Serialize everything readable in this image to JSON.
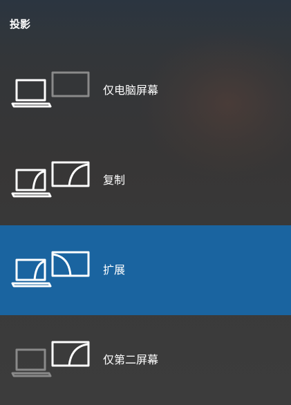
{
  "panel": {
    "title": "投影"
  },
  "options": [
    {
      "label": "仅电脑屏幕",
      "selected": false
    },
    {
      "label": "复制",
      "selected": false
    },
    {
      "label": "扩展",
      "selected": true
    },
    {
      "label": "仅第二屏幕",
      "selected": false
    }
  ],
  "colors": {
    "selected_background": "#1a64a0",
    "icon_active": "#ffffff",
    "icon_inactive": "#8a8a8a"
  }
}
